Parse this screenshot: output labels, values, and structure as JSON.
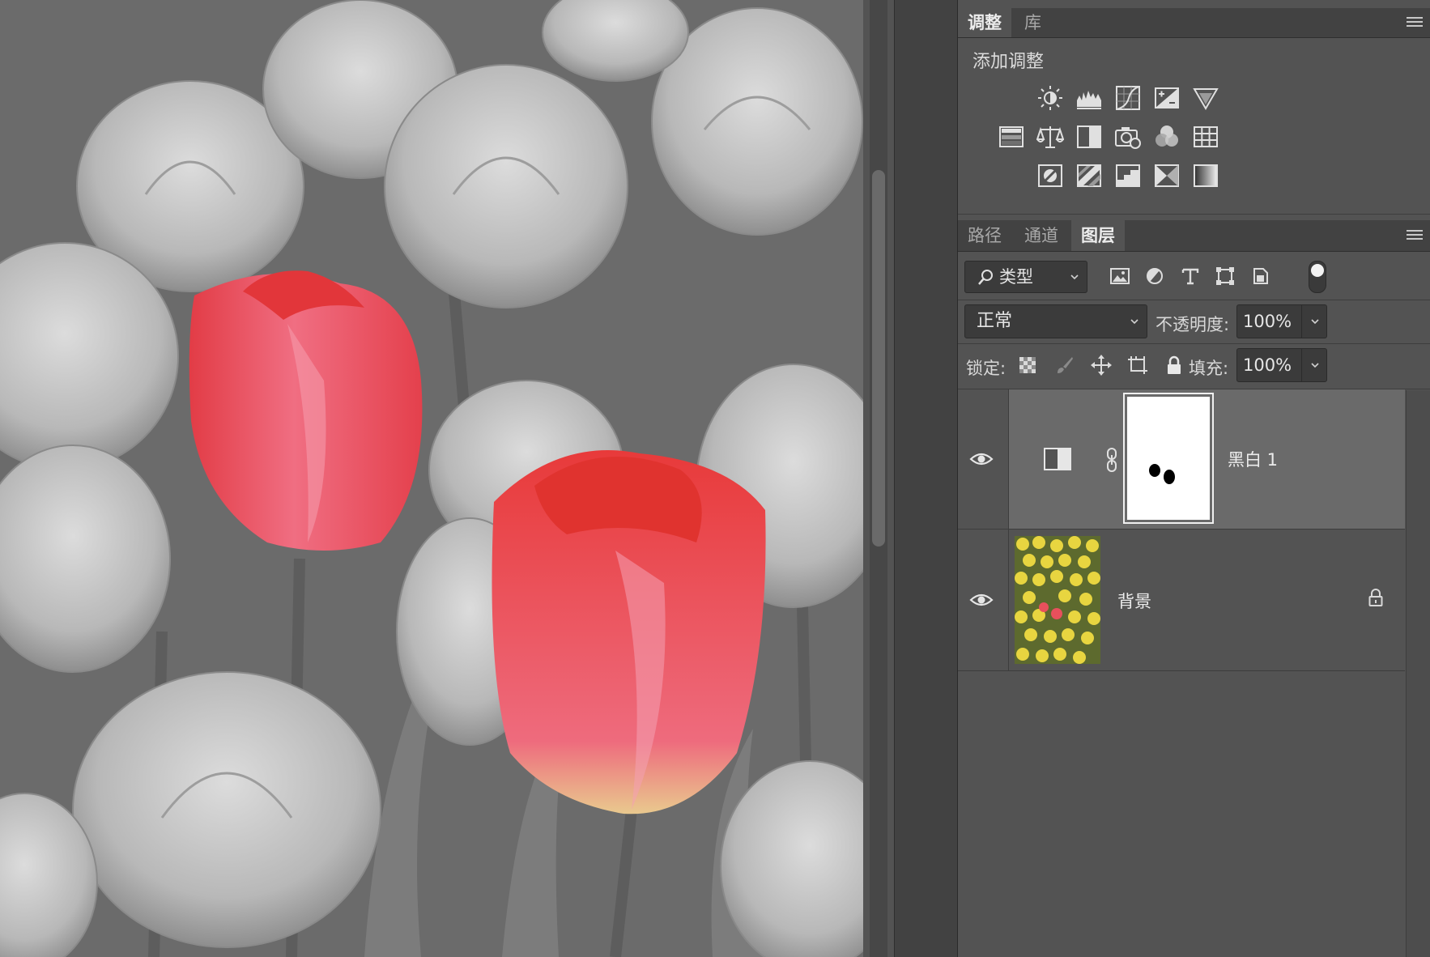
{
  "adjust_panel": {
    "tabs": [
      "调整",
      "库"
    ],
    "active_tab": "调整",
    "title": "添加调整",
    "icons_row1": [
      "brightness-contrast-icon",
      "levels-icon",
      "curves-icon",
      "exposure-icon",
      "vibrance-icon"
    ],
    "icons_row2": [
      "hue-saturation-icon",
      "color-balance-icon",
      "black-white-icon",
      "photo-filter-icon",
      "channel-mixer-icon",
      "color-lookup-icon"
    ],
    "icons_row3": [
      "invert-icon",
      "posterize-icon",
      "threshold-icon",
      "selective-color-icon",
      "gradient-map-icon"
    ]
  },
  "layers_panel": {
    "tabs": [
      "路径",
      "通道",
      "图层"
    ],
    "active_tab": "图层",
    "filter": {
      "kind_label": "类型",
      "icons": [
        "pixel-filter-icon",
        "adjustment-filter-icon",
        "type-filter-icon",
        "shape-filter-icon",
        "smart-object-filter-icon"
      ]
    },
    "blend_mode": "正常",
    "opacity_label": "不透明度:",
    "opacity_value": "100%",
    "lock_label": "锁定:",
    "fill_label": "填充:",
    "fill_value": "100%",
    "layers": [
      {
        "name": "黑白 1",
        "type": "adjustment",
        "visible": true,
        "selected": true
      },
      {
        "name": "背景",
        "type": "pixel",
        "visible": true,
        "locked": true
      }
    ]
  },
  "colors": {
    "panel_bg": "#535353",
    "tab_bar_bg": "#424242",
    "selected_layer_bg": "#6a6a6a",
    "field_bg": "#3b3b3b",
    "tulip_red": "#e8505c"
  }
}
